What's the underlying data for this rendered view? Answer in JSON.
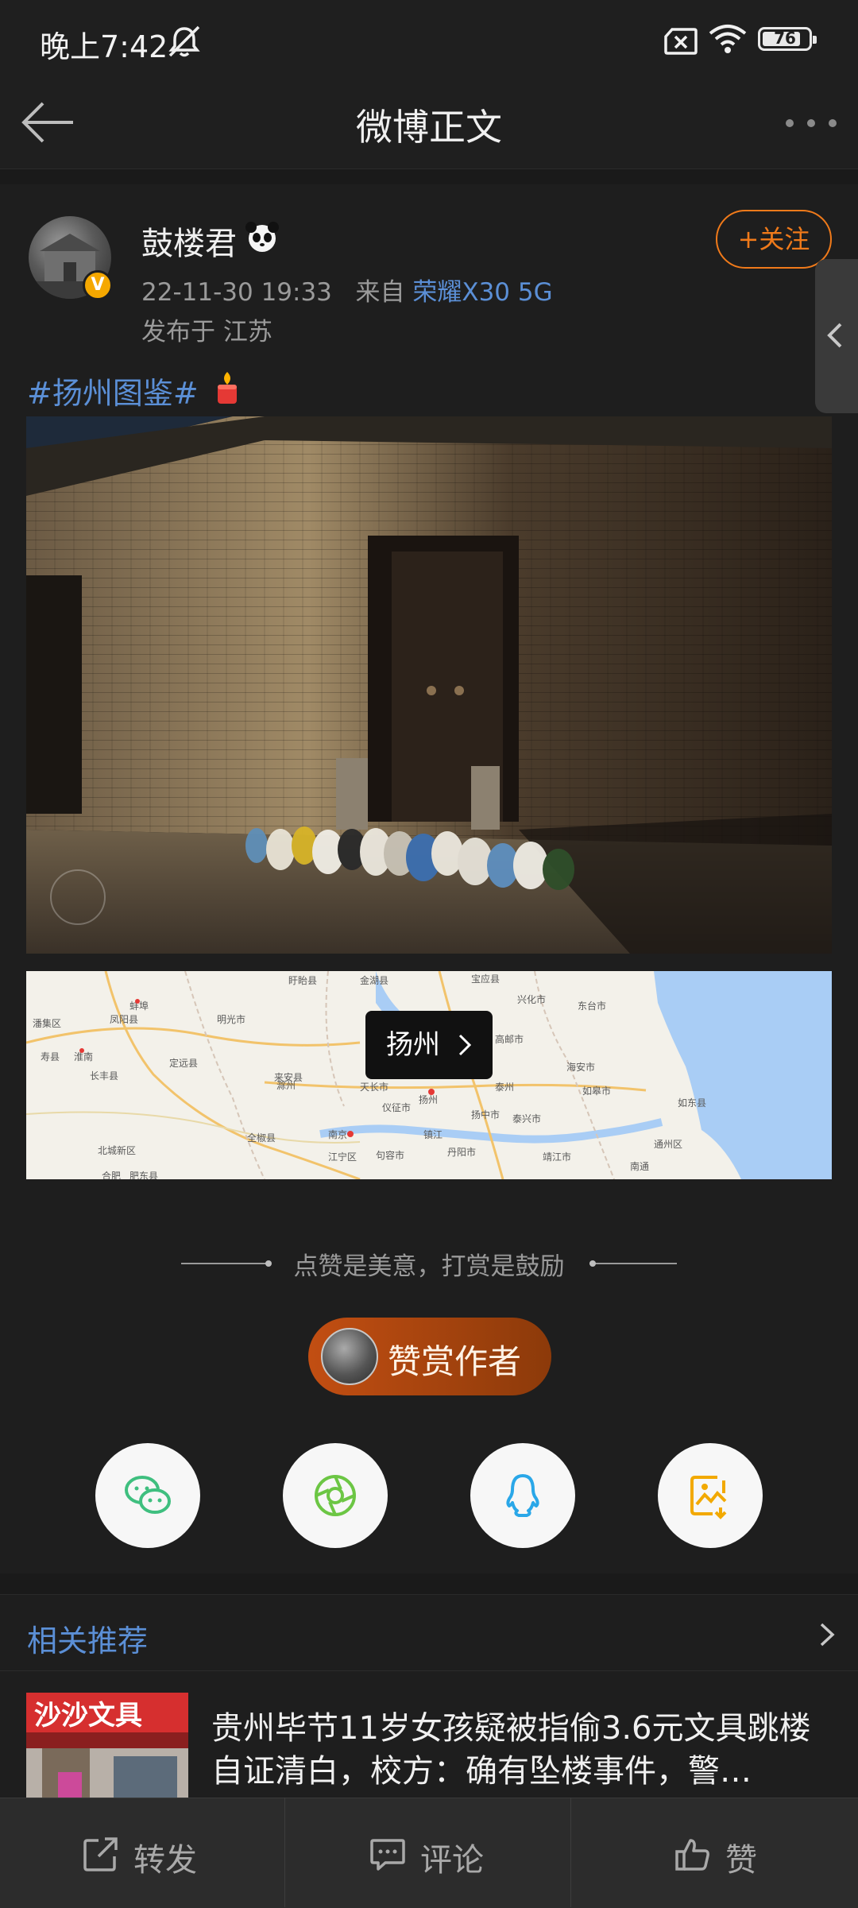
{
  "status_bar": {
    "time": "晚上7:42",
    "battery": "76",
    "battery_level": 0.76
  },
  "nav": {
    "title": "微博正文"
  },
  "post": {
    "username": "鼓楼君",
    "timestamp": "22-11-30 19:33",
    "source_prefix": "来自",
    "device": "荣耀X30 5G",
    "location": "发布于 江苏",
    "follow_label": "+关注",
    "topic": "#扬州图鉴#",
    "verified_mark": "V"
  },
  "map": {
    "pin_label": "扬州",
    "places": [
      "蚌埠",
      "淮南",
      "寿县",
      "滁州",
      "明光市",
      "天长市",
      "金湖县",
      "盱眙县",
      "宝应县",
      "兴化市",
      "东台市",
      "高邮市",
      "泰州",
      "海安市",
      "如皋市",
      "如东县",
      "南京",
      "仪征市",
      "扬州",
      "镇江",
      "扬中市",
      "泰兴市",
      "靖江市",
      "南通",
      "通州区",
      "句容市",
      "丹阳市",
      "全椒县",
      "来安县",
      "定远县",
      "长丰县",
      "合肥",
      "肥东县",
      "北城新区",
      "江宁区",
      "凤阳县",
      "潘集区"
    ]
  },
  "reward": {
    "tagline": "点赞是美意，打赏是鼓励",
    "button_label": "赞赏作者"
  },
  "share": [
    {
      "name": "wechat",
      "icon": "wechat-icon",
      "color": "#3fbf7f"
    },
    {
      "name": "moments",
      "icon": "moments-icon",
      "color": "#6cc644"
    },
    {
      "name": "qq",
      "icon": "qq-icon",
      "color": "#2aa7e8"
    },
    {
      "name": "save-image",
      "icon": "save-image-icon",
      "color": "#f2a900"
    }
  ],
  "related": {
    "title": "相关推荐",
    "headline": "贵州毕节11岁女孩疑被指偷3.6元文具跳楼自证清白，校方：确有坠楼事件，警…",
    "thumb_sign": "沙沙文具"
  },
  "bottom_bar": {
    "repost": "转发",
    "comment": "评论",
    "like": "赞"
  }
}
